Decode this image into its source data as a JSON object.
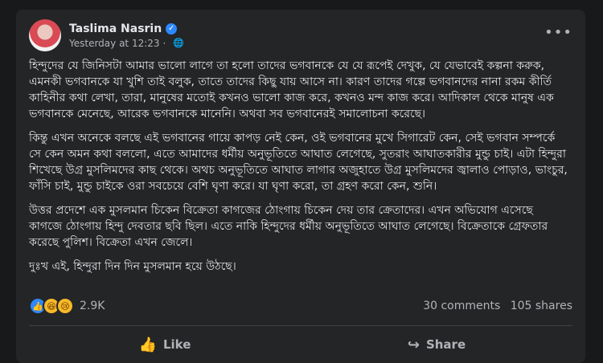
{
  "post": {
    "author": "Taslima Nasrin",
    "timestamp": "Yesterday at 12:23",
    "more_icon": "more-horizontal-icon",
    "privacy_icon": "globe-icon",
    "paragraphs": [
      "হিন্দুদের যে জিনিসটা আমার ভালো লাগে তা হলো তাদের ভগবানকে যে যে রূপেই দেখুক, যে যেভাবেই কল্পনা করুক, এমনকী ভগবানকে যা খুশি তাই বলুক, তাতে তাদের কিছু যায় আসে না। কারণ তাদের গল্পে ভগবানদের নানা রকম কীর্তি কাহিনীর কথা লেখা, তারা, মানুষের মতোই কখনও ভালো কাজ করে, কখনও মন্দ কাজ করে। আদিকাল থেকে মানুষ এক ভগবানকে মেনেছে, আরেক ভগবানকে মানেনি। অথবা সব ভগবানেরই সমালোচনা করেছে।",
      "কিন্তু এখন অনেকে বলছে এই ভগবানের গায়ে কাপড় নেই কেন, ওই ভগবানের মুখে সিগারেট কেন, সেই ভগবান সম্পর্কে সে কেন অমন কথা বললো, এতে আমাদের ধর্মীয় অনুভূতিতে আঘাত লেগেছে, সুতরাং আঘাতকারীর মুন্ডু চাই। এটা হিন্দুরা শিখেছে উগ্র মুসলিমদের কাছ থেকে। অথচ অনুভূতিতে আঘাত লাগার অজুহাতে উগ্র মুসলিমদের জ্বালাও পোড়াও, ভাংচুর, ফাঁসি চাই, মুন্ডু চাইকে ওরা সবচেয়ে বেশি ঘৃণা করে। যা ঘৃণা করো, তা গ্রহণ করো কেন, শুনি।",
      "উত্তর প্রদেশে এক মুসলমান চিকেন বিক্রেতা কাগজের ঠোংগায় চিকেন দেয় তার ক্রেতাদের। এখন অভিযোগ এসেছে কাগজে ঠোংগায় হিন্দু দেবতার ছবি ছিল। এতে নাকি হিন্দুদের ধর্মীয় অনুভূতিতে আঘাত লেগেছে। বিক্রেতাকে গ্রেফতার করেছে পুলিশ। বিক্রেতা এখন জেলে।",
      "দুঃখ এই, হিন্দুরা দিন দিন মুসলমান হয়ে উঠছে।"
    ]
  },
  "stats": {
    "reaction_icons": [
      "like-icon",
      "haha-icon",
      "sad-icon"
    ],
    "reaction_count": "2.9K",
    "comments": "30 comments",
    "shares": "105 shares"
  },
  "actions": {
    "like_label": "Like",
    "share_label": "Share"
  }
}
